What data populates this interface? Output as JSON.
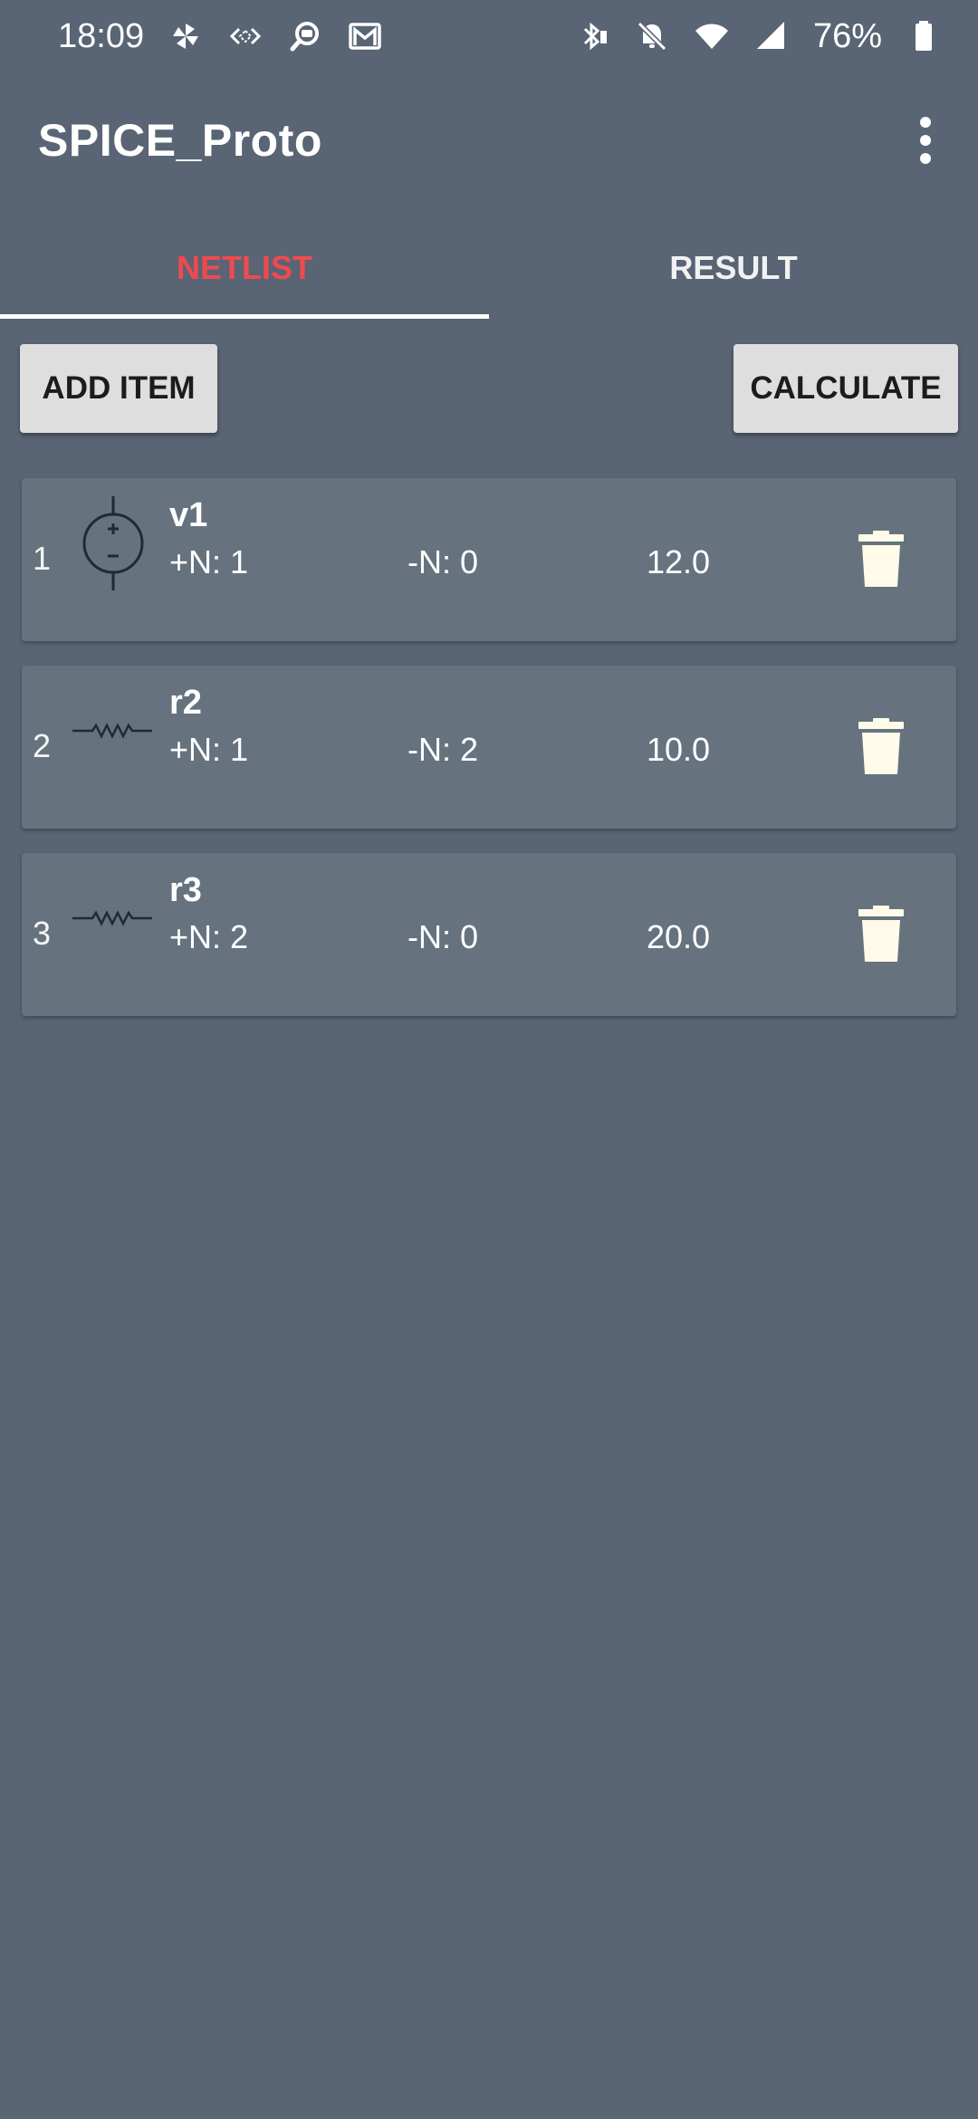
{
  "status_bar": {
    "time": "18:09",
    "battery": "76%",
    "left_icons": [
      "pinwheel-icon",
      "diamond-arrows-icon",
      "chat-search-icon",
      "gmail-icon"
    ],
    "right_icons": [
      "bluetooth-icon",
      "bell-off-icon",
      "wifi-icon",
      "signal-icon",
      "battery-icon"
    ]
  },
  "app_bar": {
    "title": "SPICE_Proto",
    "menu_icon": "more-vert-icon"
  },
  "tabs": [
    {
      "label": "NETLIST",
      "active": true
    },
    {
      "label": "RESULT",
      "active": false
    }
  ],
  "actions": {
    "add_label": "ADD ITEM",
    "calculate_label": "CALCULATE"
  },
  "items": [
    {
      "index": "1",
      "name": "v1",
      "pos": "+N: 1",
      "neg": "-N: 0",
      "value": "12.0",
      "symbol": "voltage-source-icon"
    },
    {
      "index": "2",
      "name": "r2",
      "pos": "+N: 1",
      "neg": "-N: 2",
      "value": "10.0",
      "symbol": "resistor-icon"
    },
    {
      "index": "3",
      "name": "r3",
      "pos": "+N: 2",
      "neg": "-N: 0",
      "value": "20.0",
      "symbol": "resistor-icon"
    }
  ],
  "colors": {
    "background": "#596474",
    "card": "#66737f",
    "active_tab": "#ef4a4f",
    "button": "#dedede",
    "delete_icon": "#fffbe8"
  }
}
